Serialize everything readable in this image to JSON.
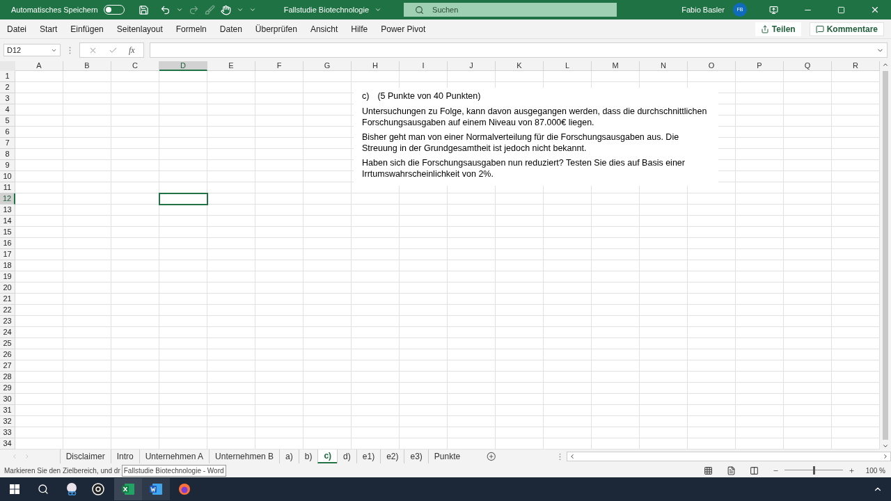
{
  "titlebar": {
    "autosave_label": "Automatisches Speichern",
    "autosave_on": false,
    "document": "Fallstudie Biotechnologie",
    "search_placeholder": "Suchen",
    "user": "Fabio Basler",
    "avatar": "FB"
  },
  "menu": [
    "Datei",
    "Start",
    "Einfügen",
    "Seitenlayout",
    "Formeln",
    "Daten",
    "Überprüfen",
    "Ansicht",
    "Hilfe",
    "Power Pivot"
  ],
  "ribbon_buttons": [
    "Teilen",
    "Kommentare"
  ],
  "formula_bar": {
    "name_box": "D12",
    "fx": "fx"
  },
  "grid": {
    "columns": [
      {
        "label": "A",
        "selected": false
      },
      {
        "label": "B",
        "selected": false
      },
      {
        "label": "C",
        "selected": false
      },
      {
        "label": "D",
        "selected": true
      },
      {
        "label": "E",
        "selected": false
      },
      {
        "label": "F",
        "selected": false
      },
      {
        "label": "G",
        "selected": false
      },
      {
        "label": "H",
        "selected": false
      },
      {
        "label": "I",
        "selected": false
      },
      {
        "label": "J",
        "selected": false
      },
      {
        "label": "K",
        "selected": false
      },
      {
        "label": "L",
        "selected": false
      },
      {
        "label": "M",
        "selected": false
      },
      {
        "label": "N",
        "selected": false
      },
      {
        "label": "O",
        "selected": false
      },
      {
        "label": "P",
        "selected": false
      },
      {
        "label": "Q",
        "selected": false
      },
      {
        "label": "R",
        "selected": false
      }
    ],
    "rows": [
      {
        "label": "1",
        "selected": false
      },
      {
        "label": "2",
        "selected": false
      },
      {
        "label": "3",
        "selected": false
      },
      {
        "label": "4",
        "selected": false
      },
      {
        "label": "5",
        "selected": false
      },
      {
        "label": "6",
        "selected": false
      },
      {
        "label": "7",
        "selected": false
      },
      {
        "label": "8",
        "selected": false
      },
      {
        "label": "9",
        "selected": false
      },
      {
        "label": "10",
        "selected": false
      },
      {
        "label": "11",
        "selected": false
      },
      {
        "label": "12",
        "selected": true
      },
      {
        "label": "13",
        "selected": false
      },
      {
        "label": "14",
        "selected": false
      },
      {
        "label": "15",
        "selected": false
      },
      {
        "label": "16",
        "selected": false
      },
      {
        "label": "17",
        "selected": false
      },
      {
        "label": "18",
        "selected": false
      },
      {
        "label": "19",
        "selected": false
      },
      {
        "label": "20",
        "selected": false
      },
      {
        "label": "21",
        "selected": false
      },
      {
        "label": "22",
        "selected": false
      },
      {
        "label": "23",
        "selected": false
      },
      {
        "label": "24",
        "selected": false
      },
      {
        "label": "25",
        "selected": false
      },
      {
        "label": "26",
        "selected": false
      },
      {
        "label": "27",
        "selected": false
      },
      {
        "label": "28",
        "selected": false
      },
      {
        "label": "29",
        "selected": false
      },
      {
        "label": "30",
        "selected": false
      },
      {
        "label": "31",
        "selected": false
      },
      {
        "label": "32",
        "selected": false
      },
      {
        "label": "33",
        "selected": false
      },
      {
        "label": "34",
        "selected": false
      }
    ]
  },
  "task_box": {
    "label": "c)",
    "heading": "(5 Punkte von 40 Punkten)",
    "paragraphs": [
      "Untersuchungen zu Folge, kann davon ausgegangen werden, dass die durchschnittlichen Forschungsausgaben auf einem Niveau von 87.000€ liegen.",
      "Bisher geht man von einer Normalverteilung für die Forschungsausgaben aus. Die Streuung in der Grundgesamtheit ist jedoch nicht bekannt.",
      "Haben sich die Forschungsausgaben nun reduziert? Testen Sie dies auf Basis einer Irrtumswahrscheinlichkeit von 2%."
    ]
  },
  "sheet_tabs": [
    {
      "label": "Disclaimer",
      "selected": false
    },
    {
      "label": "Intro",
      "selected": false
    },
    {
      "label": "Unternehmen A",
      "selected": false
    },
    {
      "label": "Unternehmen B",
      "selected": false
    },
    {
      "label": "a)",
      "selected": false
    },
    {
      "label": "b)",
      "selected": false
    },
    {
      "label": "c)",
      "selected": true
    },
    {
      "label": "d)",
      "selected": false
    },
    {
      "label": "e1)",
      "selected": false
    },
    {
      "label": "e2)",
      "selected": false
    },
    {
      "label": "e3)",
      "selected": false
    },
    {
      "label": "Punkte",
      "selected": false
    }
  ],
  "status_bar": {
    "message": "Markieren Sie den Zielbereich, und dr",
    "tooltip": "Fallstudie Biotechnologie - Word",
    "zoom": {
      "level": 0.5
    },
    "zoom_text": "100 %"
  }
}
